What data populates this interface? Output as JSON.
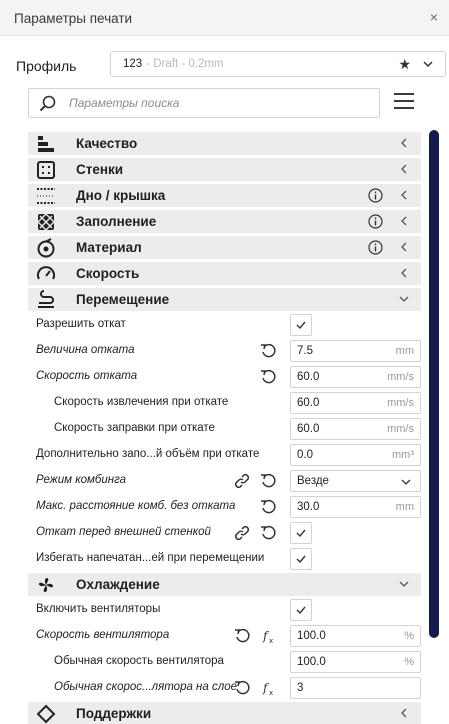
{
  "window": {
    "title": "Параметры печати",
    "close_glyph": "×"
  },
  "profile": {
    "label": "Профиль",
    "name": "123",
    "subtitle": "- Draft - 0.2mm"
  },
  "search": {
    "placeholder": "Параметры поиска"
  },
  "categories": {
    "quality": {
      "label": "Качество",
      "icon": "layer-height-icon"
    },
    "walls": {
      "label": "Стенки",
      "icon": "walls-icon"
    },
    "topbottom": {
      "label": "Дно / крышка",
      "icon": "top-bottom-icon"
    },
    "infill": {
      "label": "Заполнение",
      "icon": "infill-icon"
    },
    "material": {
      "label": "Материал",
      "icon": "material-icon"
    },
    "speed": {
      "label": "Скорость",
      "icon": "speed-icon"
    },
    "travel": {
      "label": "Перемещение",
      "icon": "travel-icon"
    },
    "cooling": {
      "label": "Охлаждение",
      "icon": "fan-icon"
    },
    "support": {
      "label": "Поддержки",
      "icon": "support-icon"
    }
  },
  "travel": {
    "retraction_enable": {
      "label": "Разрешить откат",
      "checked": true
    },
    "retraction_amount": {
      "label": "Величина отката",
      "value": "7.5",
      "unit": "mm"
    },
    "retraction_speed": {
      "label": "Скорость отката",
      "value": "60.0",
      "unit": "mm/s"
    },
    "retraction_retract_speed": {
      "label": "Скорость извлечения при откате",
      "value": "60.0",
      "unit": "mm/s"
    },
    "retraction_prime_speed": {
      "label": "Скорость заправки при откате",
      "value": "60.0",
      "unit": "mm/s"
    },
    "retraction_extra_prime": {
      "label": "Дополнительно запо...й объём при откате",
      "value": "0.0",
      "unit": "mm³"
    },
    "combing_mode": {
      "label": "Режим комбинга",
      "value": "Везде"
    },
    "combing_max_distance": {
      "label": "Макс. расстояние комб. без отката",
      "value": "30.0",
      "unit": "mm"
    },
    "retract_before_outer_wall": {
      "label": "Откат перед внешней стенкой",
      "checked": true
    },
    "avoid_printed_parts": {
      "label": "Избегать напечатан...ей при перемещении",
      "checked": true
    }
  },
  "cooling": {
    "fan_enabled": {
      "label": "Включить вентиляторы",
      "checked": true
    },
    "fan_speed": {
      "label": "Скорость вентилятора",
      "value": "100.0",
      "unit": "%"
    },
    "fan_speed_min": {
      "label": "Обычная скорость вентилятора",
      "value": "100.0",
      "unit": "%"
    },
    "fan_full_layer": {
      "label": "Обычная скорос...лятора на слое",
      "value": "3"
    }
  },
  "colors": {
    "scrollbar": "#111b4d",
    "category_bg": "#ececec",
    "accent": "#1f1f1f"
  }
}
